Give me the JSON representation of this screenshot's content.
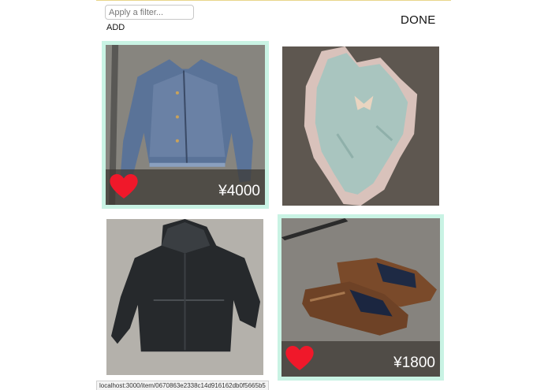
{
  "toolbar": {
    "filter_placeholder": "Apply a filter...",
    "filter_value": "",
    "add_label": "ADD",
    "done_label": "DONE"
  },
  "items": [
    {
      "name": "denim jacket",
      "selected": true,
      "favorited": true,
      "price": "¥4000"
    },
    {
      "name": "mint dress",
      "selected": false,
      "favorited": false,
      "price": ""
    },
    {
      "name": "black rain jacket",
      "selected": false,
      "favorited": false,
      "price": ""
    },
    {
      "name": "brown leather shoes",
      "selected": true,
      "favorited": true,
      "price": "¥1800"
    }
  ],
  "status_bar": {
    "url": "localhost:3000/item/0670863e2338c14d916162db0f5665b5"
  },
  "colors": {
    "selection_border": "#c9f3e4",
    "heart": "#f0182a",
    "overlay": "#3c3732"
  },
  "icons": {
    "favorite": "heart-icon"
  }
}
